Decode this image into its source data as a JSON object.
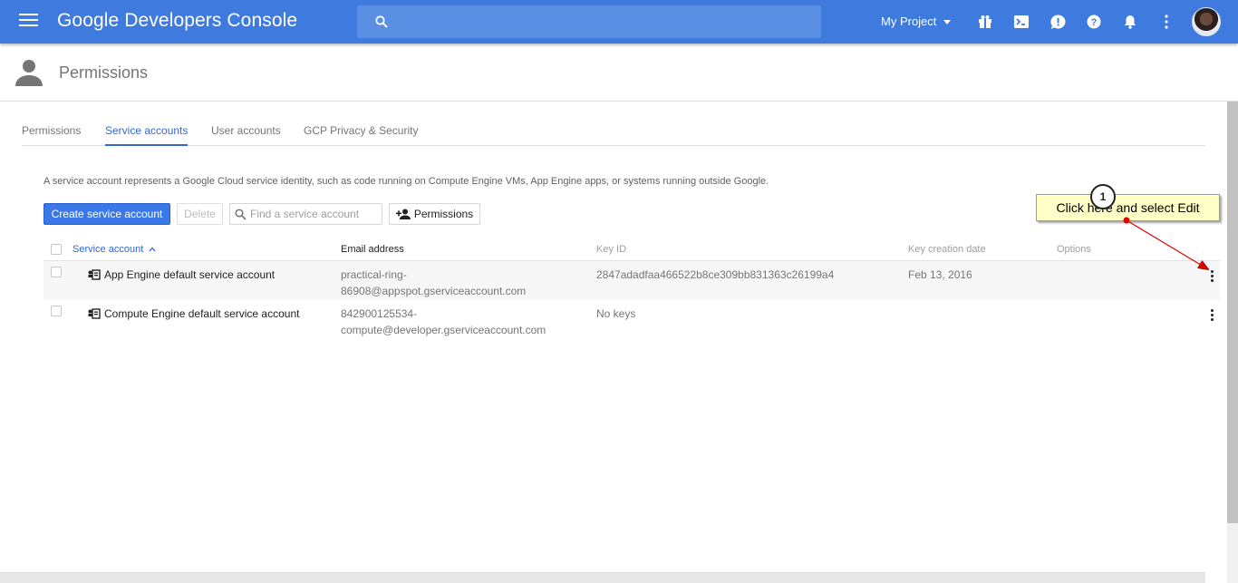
{
  "appbar": {
    "brand_google": "Google",
    "brand_product": "Developers Console",
    "search_placeholder": "",
    "project_label": "My Project",
    "icons": [
      "gift-icon",
      "terminal-icon",
      "feedback-icon",
      "help-icon",
      "notifications-icon",
      "more-vert-icon"
    ]
  },
  "page": {
    "title": "Permissions"
  },
  "tabs": [
    {
      "label": "Permissions",
      "active": false
    },
    {
      "label": "Service accounts",
      "active": true
    },
    {
      "label": "User accounts",
      "active": false
    },
    {
      "label": "GCP Privacy & Security",
      "active": false
    }
  ],
  "description": "A service account represents a Google Cloud service identity, such as code running on Compute Engine VMs, App Engine apps, or systems running outside Google.",
  "toolbar": {
    "create_label": "Create service account",
    "delete_label": "Delete",
    "find_placeholder": "Find a service account",
    "permissions_label": "Permissions"
  },
  "table": {
    "headers": {
      "service_account": "Service account",
      "email": "Email address",
      "key_id": "Key ID",
      "key_date": "Key creation date",
      "options": "Options"
    },
    "sort_indicator": "^",
    "rows": [
      {
        "name": "App Engine default service account",
        "email_line1": "practical-ring-",
        "email_line2": "86908@appspot.gserviceaccount.com",
        "key_id": "2847adadfaa466522b8ce309bb831363c26199a4",
        "key_date": "Feb 13, 2016"
      },
      {
        "name": "Compute Engine default service account",
        "email_line1": "842900125534-",
        "email_line2": "compute@developer.gserviceaccount.com",
        "key_id": "No keys",
        "key_date": ""
      }
    ]
  },
  "callout": {
    "number": "1",
    "text": "Click here and select Edit"
  },
  "colors": {
    "appbar": "#3f7bde",
    "primary": "#3b78e7",
    "active_tab": "#3367d6",
    "callout_bg": "#ffffc8",
    "arrow": "#e00000"
  }
}
